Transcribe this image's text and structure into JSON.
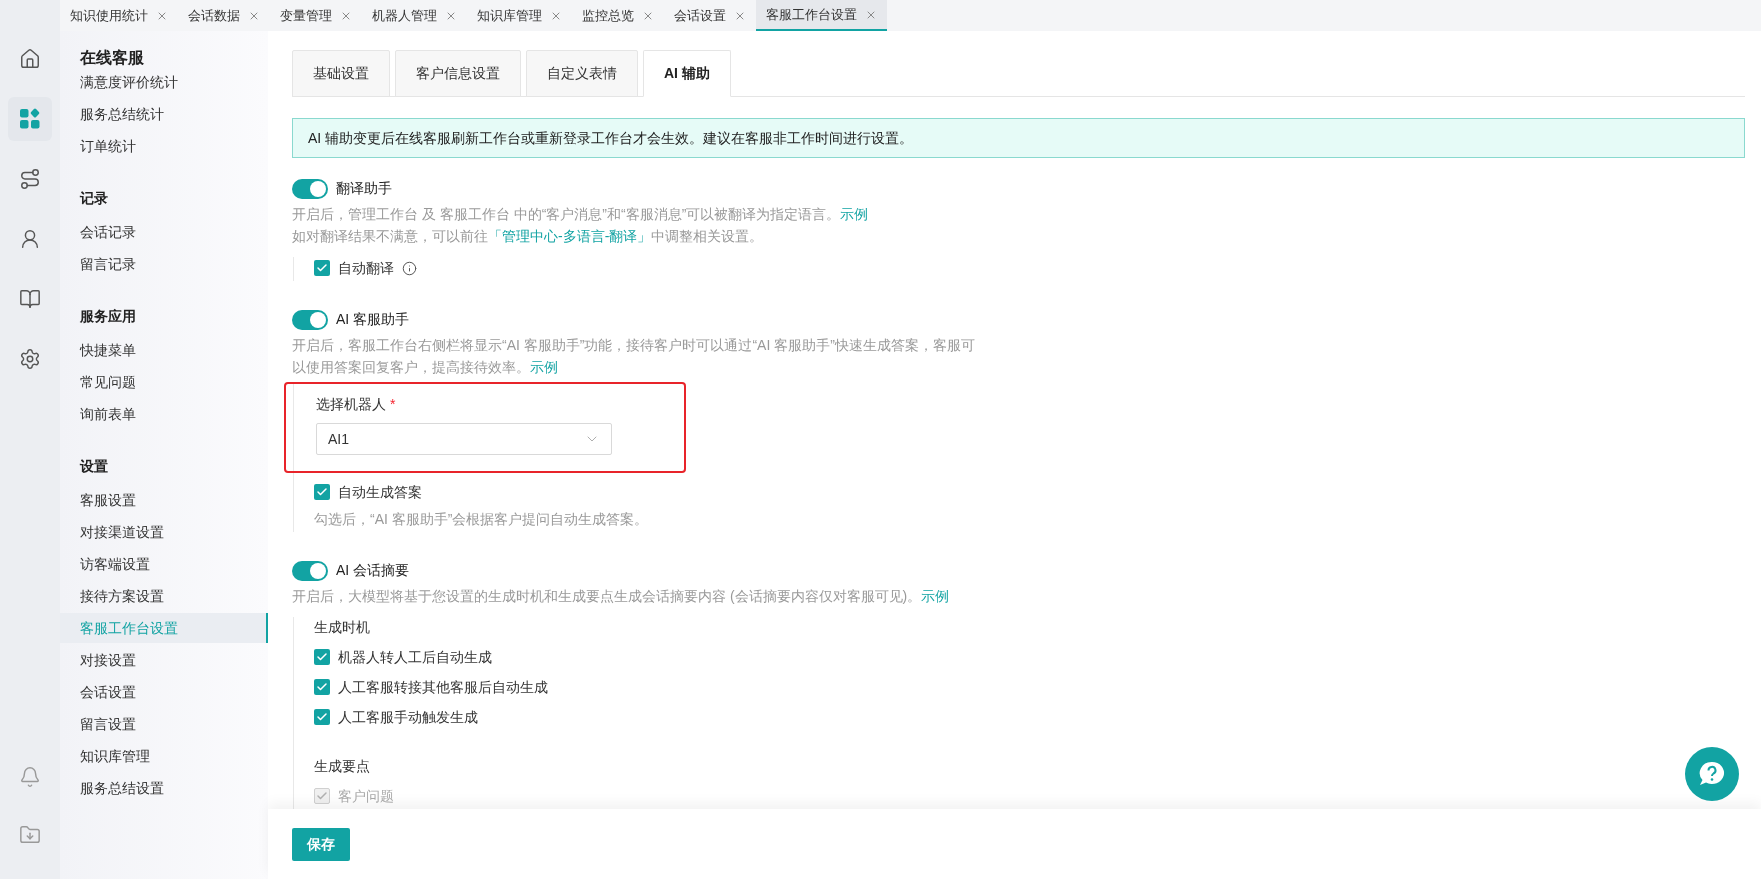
{
  "top_tabs": [
    {
      "label": "知识使用统计",
      "selected": false
    },
    {
      "label": "会话数据",
      "selected": false
    },
    {
      "label": "变量管理",
      "selected": false
    },
    {
      "label": "机器人管理",
      "selected": false
    },
    {
      "label": "知识库管理",
      "selected": false
    },
    {
      "label": "监控总览",
      "selected": false
    },
    {
      "label": "会话设置",
      "selected": false
    },
    {
      "label": "客服工作台设置",
      "selected": true
    }
  ],
  "nav_icons": [
    {
      "kind": "home",
      "selected": false
    },
    {
      "kind": "apps",
      "selected": true
    },
    {
      "kind": "flow",
      "selected": false
    },
    {
      "kind": "person",
      "selected": false
    },
    {
      "kind": "book",
      "selected": false
    },
    {
      "kind": "gear",
      "selected": false
    }
  ],
  "nav_bottom_icons": [
    {
      "kind": "bell"
    },
    {
      "kind": "download"
    }
  ],
  "sidebar": {
    "title": "在线客服",
    "groups": [
      {
        "items": [
          {
            "label": "满意度评价统计",
            "selected": false
          },
          {
            "label": "服务总结统计",
            "selected": false
          },
          {
            "label": "订单统计",
            "selected": false
          }
        ]
      },
      {
        "heading": "记录",
        "items": [
          {
            "label": "会话记录",
            "selected": false
          },
          {
            "label": "留言记录",
            "selected": false
          }
        ]
      },
      {
        "heading": "服务应用",
        "items": [
          {
            "label": "快捷菜单",
            "selected": false
          },
          {
            "label": "常见问题",
            "selected": false
          },
          {
            "label": "询前表单",
            "selected": false
          }
        ]
      },
      {
        "heading": "设置",
        "items": [
          {
            "label": "客服设置",
            "selected": false
          },
          {
            "label": "对接渠道设置",
            "selected": false
          },
          {
            "label": "访客端设置",
            "selected": false
          },
          {
            "label": "接待方案设置",
            "selected": false
          },
          {
            "label": "客服工作台设置",
            "selected": true
          },
          {
            "label": "对接设置",
            "selected": false
          },
          {
            "label": "会话设置",
            "selected": false
          },
          {
            "label": "留言设置",
            "selected": false
          },
          {
            "label": "知识库管理",
            "selected": false
          },
          {
            "label": "服务总结设置",
            "selected": false
          }
        ]
      }
    ]
  },
  "content_tabs": [
    {
      "label": "基础设置",
      "selected": false
    },
    {
      "label": "客户信息设置",
      "selected": false
    },
    {
      "label": "自定义表情",
      "selected": false
    },
    {
      "label": "AI 辅助",
      "selected": true
    }
  ],
  "notice": "AI 辅助变更后在线客服刷新工作台或重新登录工作台才会生效。建议在客服非工作时间进行设置。",
  "sections": [
    {
      "title": "翻译助手",
      "on": true,
      "description": [
        [
          {
            "text": "开启后，管理工作台 及 客服工作台 中的“客户消息”和“客服消息”可以被翻译为指定语言。"
          },
          {
            "link": "示例"
          }
        ],
        [
          {
            "text": "如对翻译结果不满意，可以前往"
          },
          {
            "link": "「管理中心-多语言-翻译」"
          },
          {
            "text": "中调整相关设置。"
          }
        ]
      ],
      "items": [
        {
          "kind": "checkbox",
          "label": "自动翻译",
          "checked": true,
          "disabled": false,
          "info": true
        }
      ]
    },
    {
      "title": "AI 客服助手",
      "on": true,
      "description": [
        [
          {
            "text": "开启后，客服工作台右侧栏将显示“AI 客服助手”功能，接待客户时可以通过“AI 客服助手”快速生成答案，客服可以使用答案回复客户，提高接待效率。"
          },
          {
            "link": "示例"
          }
        ]
      ],
      "items": [
        {
          "kind": "select",
          "label": "选择机器人",
          "required_mark": "*",
          "value": "AI1",
          "highlighted": true
        },
        {
          "kind": "checkbox",
          "label": "自动生成答案",
          "checked": true,
          "disabled": false,
          "hint": "勾选后，“AI 客服助手”会根据客户提问自动生成答案。"
        }
      ]
    },
    {
      "title": "AI 会话摘要",
      "on": true,
      "description": [
        [
          {
            "text": "开启后，大模型将基于您设置的生成时机和生成要点生成会话摘要内容 (会话摘要内容仅对客服可见)。"
          },
          {
            "link": "示例"
          }
        ]
      ],
      "items": [
        {
          "kind": "heading",
          "label": "生成时机"
        },
        {
          "kind": "checkbox",
          "label": "机器人转人工后自动生成",
          "checked": true,
          "disabled": false
        },
        {
          "kind": "checkbox",
          "label": "人工客服转接其他客服后自动生成",
          "checked": true,
          "disabled": false
        },
        {
          "kind": "checkbox",
          "label": "人工客服手动触发生成",
          "checked": true,
          "disabled": false
        },
        {
          "kind": "heading",
          "label": "生成要点"
        },
        {
          "kind": "checkbox",
          "label": "客户问题",
          "checked": true,
          "disabled": true
        }
      ]
    }
  ],
  "save_button": "保存"
}
